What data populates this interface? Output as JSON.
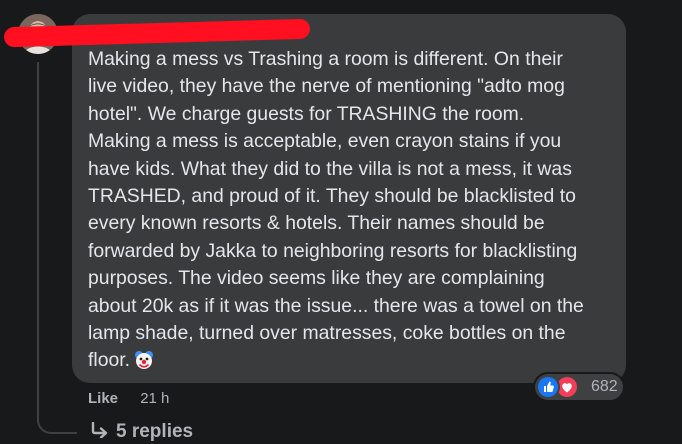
{
  "comment": {
    "lines": [
      "Making a mess vs Trashing a room is different. On their",
      "live video, they have the nerve of mentioning \"adto mog",
      "hotel\". We charge guests for TRASHING the room.",
      "Making a mess is acceptable, even crayon stains if you",
      "have kids. What they did to the villa is not a mess, it was",
      "TRASHED, and proud of it. They should be blacklisted to",
      "every known resorts & hotels. Their names should be",
      "forwarded by Jakka to neighboring resorts for blacklisting",
      "purposes. The video seems like they are complaining",
      "about 20k as if it was the issue... there was a towel on the",
      "lamp shade, turned over matresses, coke bottles on the",
      "floor."
    ],
    "emoji_icon": "clown-face-icon"
  },
  "reactions": {
    "count": "682",
    "icons": [
      "like-icon",
      "love-icon"
    ],
    "like_color": "#1877f2",
    "love_color": "#f33e58"
  },
  "actions": {
    "like_label": "Like",
    "timestamp": "21 h"
  },
  "replies": {
    "label": "5 replies"
  }
}
